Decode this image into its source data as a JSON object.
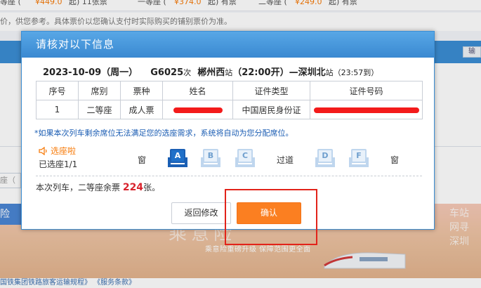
{
  "background": {
    "fare_row": [
      "等座 (",
      "¥449.0",
      "起) 11张票",
      "一等座 (",
      "¥374.0",
      "起) 有票",
      "二等座 (",
      "¥249.0",
      "起) 有票"
    ],
    "notice": "价，供您参考。具体票价以您确认支付时实际购买的铺别票价为准。",
    "band_input": "输",
    "seat_search": "座（",
    "banner_left": "险",
    "banner_slogan": "乘意险重磅升级 保障范围更全面",
    "banner_big": "乘意险",
    "banner_right": "车站 网寻 深圳",
    "footer": "国铁集团铁路旅客运输规程》 《服务条款》"
  },
  "dialog": {
    "title": "请核对以下信息",
    "train": {
      "date": "2023-10-09（周一）",
      "train_no": "G6025",
      "train_suffix": "次",
      "from": "郴州西",
      "from_suffix": "站",
      "depart": "（22:00开）—",
      "to": "深圳北",
      "to_suffix": "站",
      "arrive": "（23:57到）"
    },
    "table": {
      "headers": [
        "序号",
        "席别",
        "票种",
        "姓名",
        "证件类型",
        "证件号码"
      ],
      "rows": [
        {
          "index": "1",
          "seat_class": "二等座",
          "ticket_type": "成人票",
          "name": "",
          "id_type": "中国居民身份证",
          "id_number": ""
        }
      ]
    },
    "notice": "*如果本次列车剩余席位无法满足您的选座需求，系统将自动为您分配席位。",
    "seat_select": {
      "title": "选座啦",
      "count": "已选座1/1",
      "window_left": "窗",
      "aisle": "过道",
      "window_right": "窗",
      "seats": [
        {
          "letter": "A",
          "selected": true
        },
        {
          "letter": "B",
          "selected": false
        },
        {
          "letter": "C",
          "selected": false
        },
        {
          "letter": "D",
          "selected": false
        },
        {
          "letter": "F",
          "selected": false
        }
      ]
    },
    "remain": {
      "prefix": "本次列车，二等座余票 ",
      "count": "224",
      "suffix": "张。"
    },
    "buttons": {
      "back": "返回修改",
      "confirm": "确认"
    },
    "colors": {
      "accent": "#3b8ed4",
      "confirm": "#fb7f21",
      "highlight": "#e2231a",
      "redaction": "#f31b1b"
    }
  }
}
